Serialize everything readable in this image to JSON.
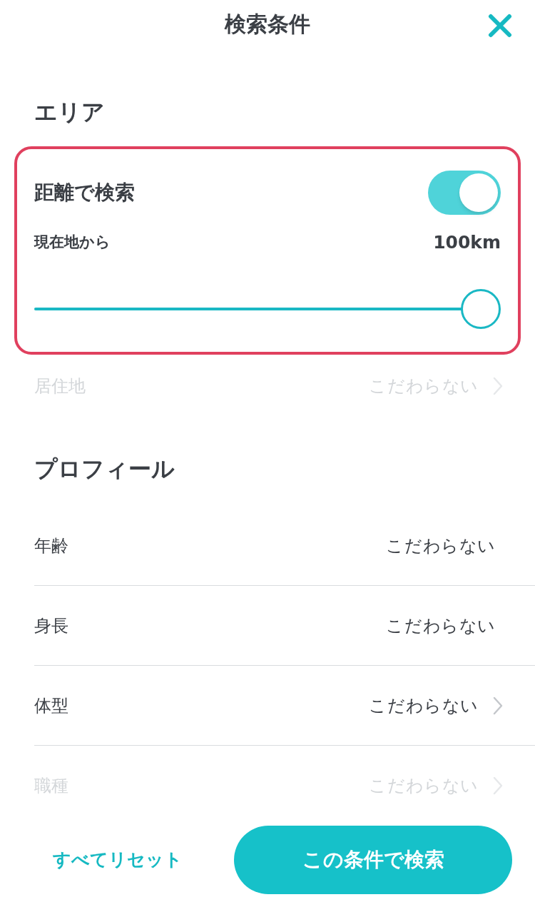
{
  "header": {
    "title": "検索条件"
  },
  "area": {
    "heading": "エリア",
    "distance": {
      "label": "距離で検索",
      "on": true,
      "from_label": "現在地から",
      "reading": "100km",
      "level": 1.0
    },
    "rows": [
      {
        "label": "居住地",
        "value": "こだわらない",
        "chevron": true,
        "disabled": true
      }
    ]
  },
  "profile": {
    "heading": "プロフィール",
    "rows": [
      {
        "label": "年齢",
        "value": "こだわらない",
        "chevron": false,
        "disabled": false
      },
      {
        "label": "身長",
        "value": "こだわらない",
        "chevron": false,
        "disabled": false
      },
      {
        "label": "体型",
        "value": "こだわらない",
        "chevron": true,
        "disabled": false
      },
      {
        "label": "職種",
        "value": "こだわらない",
        "chevron": true,
        "disabled": true
      }
    ]
  },
  "footer": {
    "reset": "すべてリセット",
    "search": "この条件で検索"
  }
}
